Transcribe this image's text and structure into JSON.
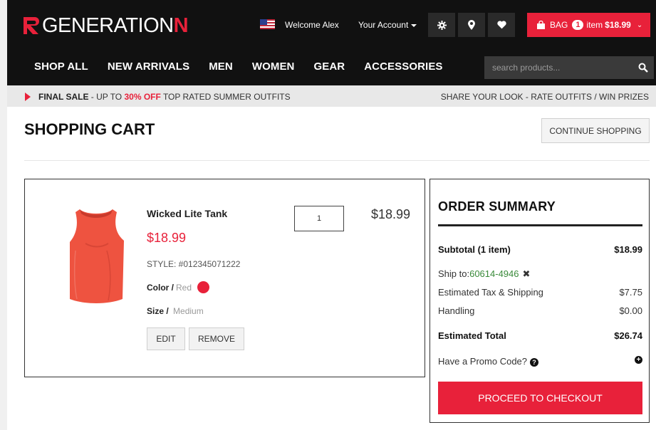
{
  "brand": {
    "name_main": "GENERATION",
    "name_accent": "N"
  },
  "header": {
    "welcome": "Welcome Alex",
    "account": "Your Account",
    "bag": {
      "label": "BAG",
      "count": "1",
      "items_text": "item",
      "total": "$18.99"
    }
  },
  "nav": {
    "items": [
      "SHOP ALL",
      "NEW ARRIVALS",
      "MEN",
      "WOMEN",
      "GEAR",
      "ACCESSORIES"
    ]
  },
  "search": {
    "placeholder": "search products..."
  },
  "promo": {
    "final_sale": "FINAL SALE",
    "mid": " - UP TO ",
    "discount": "30% OFF",
    "tail": " TOP RATED SUMMER OUTFITS",
    "right": "SHARE YOUR LOOK - RATE OUTFITS / WIN PRIZES"
  },
  "page": {
    "title": "SHOPPING CART",
    "continue_label": "CONTINUE SHOPPING"
  },
  "cart_item": {
    "name": "Wicked Lite Tank",
    "price": "$18.99",
    "style": "STYLE: #012345071222",
    "color_label": "Color /",
    "color_value": "Red",
    "size_label": "Size /",
    "size_value": "Medium",
    "quantity": "1",
    "line_total": "$18.99",
    "edit_label": "EDIT",
    "remove_label": "REMOVE"
  },
  "summary": {
    "title": "ORDER SUMMARY",
    "subtotal_label": "Subtotal (1 item)",
    "subtotal_value": "$18.99",
    "ship_label": "Ship to: ",
    "ship_zip": "60614-4946",
    "tax_label": "Estimated Tax & Shipping",
    "tax_value": "$7.75",
    "handling_label": "Handling",
    "handling_value": "$0.00",
    "total_label": "Estimated Total",
    "total_value": "$26.74",
    "promo_label": "Have a Promo Code?",
    "checkout_label": "PROCEED TO CHECKOUT"
  },
  "colors": {
    "accent": "#e8213a",
    "header_bg": "#111111",
    "zip_green": "#3a8a3a"
  }
}
